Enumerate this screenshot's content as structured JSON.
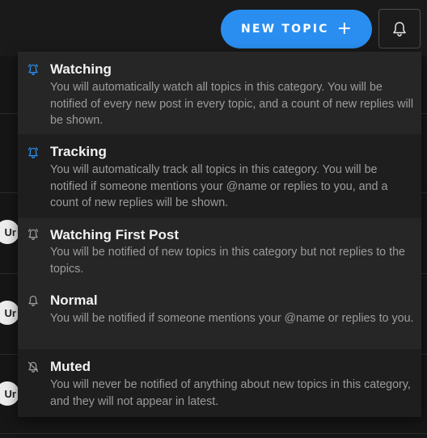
{
  "header": {
    "new_topic_label": "NEW TOPIC",
    "new_topic_plus": "+",
    "notification_button_icon": "bell-icon"
  },
  "background": {
    "avatars": [
      "Ur",
      "Ur",
      "Ur"
    ]
  },
  "menu": {
    "items": [
      {
        "title": "Watching",
        "description": "You will automatically watch all topics in this category. You will be notified of every new post in every topic, and a count of new replies will be shown.",
        "icon": "bell-alert-icon",
        "icon_color": "#2a8ef0"
      },
      {
        "title": "Tracking",
        "description": "You will automatically track all topics in this category. You will be notified if someone mentions your @name or replies to you, and a count of new replies will be shown.",
        "icon": "bell-alert-icon",
        "icon_color": "#2a8ef0"
      },
      {
        "title": "Watching First Post",
        "description": "You will be notified of new topics in this category but not replies to the topics.",
        "icon": "bell-alert-icon",
        "icon_color": "#9b9b9b"
      },
      {
        "title": "Normal",
        "description": "You will be notified if someone mentions your @name or replies to you.",
        "icon": "bell-icon",
        "icon_color": "#9b9b9b"
      },
      {
        "title": "Muted",
        "description": "You will never be notified of anything about new topics in this category, and they will not appear in latest.",
        "icon": "bell-slash-icon",
        "icon_color": "#9b9b9b"
      }
    ]
  },
  "colors": {
    "accent": "#2a8ef0",
    "menu_bg": "#262626",
    "highlight_bg": "#1e1e1e",
    "page_bg": "#161616"
  }
}
